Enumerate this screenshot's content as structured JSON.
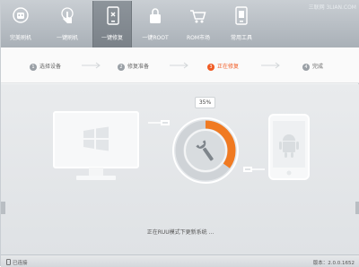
{
  "watermark": "三联网 3LIAN.COM",
  "toolbar": {
    "items": [
      {
        "label": "完美刷机",
        "icon": "robot-logo-icon"
      },
      {
        "label": "一键刷机",
        "icon": "hand-touch-icon"
      },
      {
        "label": "一键修复",
        "icon": "phone-repair-icon",
        "active": true
      },
      {
        "label": "一键ROOT",
        "icon": "lock-icon"
      },
      {
        "label": "ROM市场",
        "icon": "cart-icon"
      },
      {
        "label": "常用工具",
        "icon": "phone-tool-icon"
      }
    ]
  },
  "steps": [
    {
      "num": "1",
      "label": "选择设备"
    },
    {
      "num": "2",
      "label": "修复准备"
    },
    {
      "num": "3",
      "label": "正在修复",
      "current": true
    },
    {
      "num": "4",
      "label": "完成"
    }
  ],
  "progress": {
    "percent_label": "35%",
    "value": 0.35
  },
  "status_text": "正在RUU模式下更新系统 ...",
  "footer": {
    "device": "已连接",
    "version": "版本：2.0.0.1652"
  },
  "colors": {
    "accent": "#f05a22",
    "toolbar": "#b3b9bf"
  }
}
